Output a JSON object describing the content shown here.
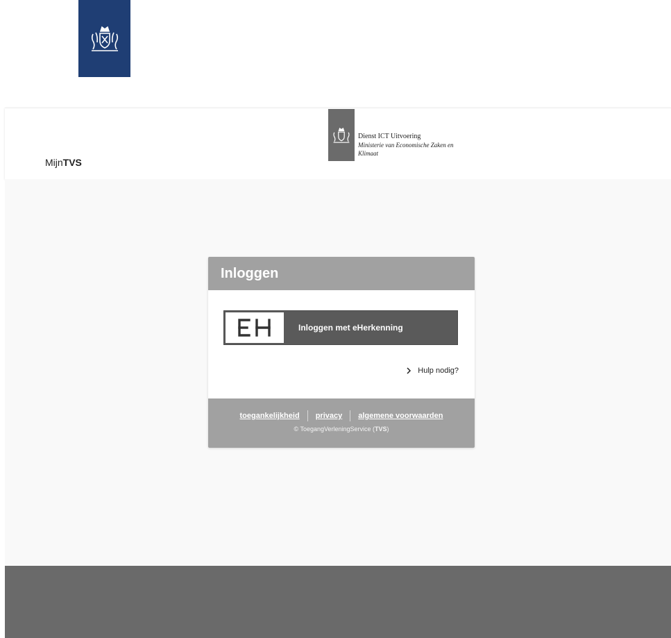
{
  "top_logo": {
    "icon": "royal-coat-of-arms-icon",
    "color": "#1f3e74"
  },
  "header": {
    "app_prefix": "Mijn",
    "app_bold": "TVS",
    "department": {
      "icon": "royal-coat-of-arms-icon",
      "name": "Dienst ICT Uitvoering",
      "ministry_line1": "Ministerie van Economische Zaken en",
      "ministry_line2": "Klimaat"
    }
  },
  "login": {
    "title": "Inloggen",
    "eherkenning_button": {
      "logo_text": "EH",
      "label": "Inloggen met eHerkenning"
    },
    "help": {
      "icon": "chevron-right-icon",
      "label": "Hulp nodig?"
    },
    "footer": {
      "links": [
        "toegankelijkheid",
        "privacy",
        "algemene voorwaarden"
      ],
      "copyright_prefix": "© ToegangVerleningService (",
      "copyright_bold": "TVS",
      "copyright_suffix": ")"
    }
  },
  "colors": {
    "card_header": "#a1a1a1",
    "eh_button": "#5a5a5a",
    "footer_band": "#6a6a6a",
    "page_background": "#f9f9f9"
  }
}
